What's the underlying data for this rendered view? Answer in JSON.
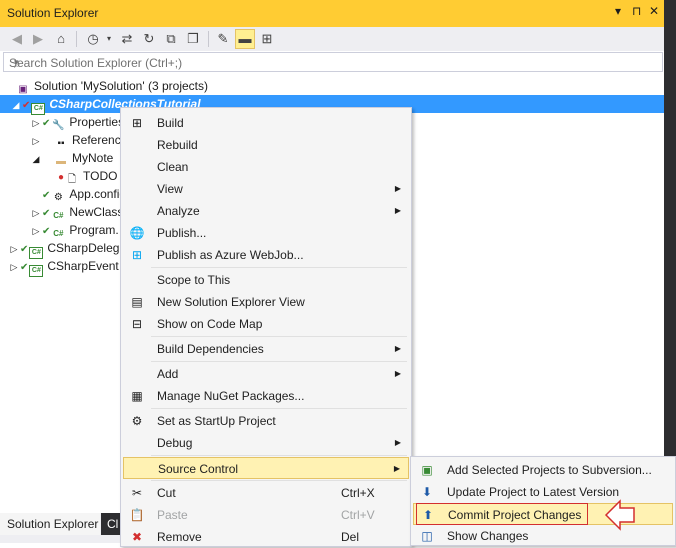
{
  "title_bar": {
    "title": "Solution Explorer",
    "dropdown_glyph": "▾",
    "pin_glyph": "⊓",
    "close_glyph": "✕"
  },
  "toolbar": {
    "icons": [
      "back-icon",
      "forward-icon",
      "home-icon",
      "history-icon",
      "sync-icon",
      "refresh-icon",
      "collapse-all-icon",
      "show-all-files-icon",
      "properties-icon",
      "preview-icon",
      "class-view-icon"
    ]
  },
  "search": {
    "placeholder": "Search Solution Explorer (Ctrl+;)",
    "icon_glyph": "⌕",
    "dropdown_glyph": "▾"
  },
  "tree": {
    "solution": "Solution 'MySolution' (3 projects)",
    "items": [
      {
        "label": "CSharpCollectionsTutorial"
      },
      {
        "label": "Properties"
      },
      {
        "label": "References"
      },
      {
        "label": "MyNote"
      },
      {
        "label": "TODO"
      },
      {
        "label": "App.config"
      },
      {
        "label": "NewClass"
      },
      {
        "label": "Program."
      },
      {
        "label": "CSharpDeleg"
      },
      {
        "label": "CSharpEvent"
      }
    ]
  },
  "bottom_tabs": {
    "tab1": "Solution Explorer",
    "tab2": "Cl"
  },
  "context_menu": {
    "items": {
      "build": "Build",
      "rebuild": "Rebuild",
      "clean": "Clean",
      "view": "View",
      "analyze": "Analyze",
      "publish": "Publish...",
      "publish_azure": "Publish as Azure WebJob...",
      "scope": "Scope to This",
      "new_view": "New Solution Explorer View",
      "code_map": "Show on Code Map",
      "build_deps": "Build Dependencies",
      "add": "Add",
      "nuget": "Manage NuGet Packages...",
      "startup": "Set as StartUp Project",
      "debug": "Debug",
      "source_control": "Source Control",
      "cut": "Cut",
      "cut_shortcut": "Ctrl+X",
      "paste": "Paste",
      "paste_shortcut": "Ctrl+V",
      "remove": "Remove",
      "remove_shortcut": "Del"
    }
  },
  "source_control_menu": {
    "add_to_svn": "Add Selected Projects to Subversion...",
    "update": "Update Project to Latest Version",
    "commit": "Commit Project Changes",
    "show_changes": "Show Changes"
  },
  "colors": {
    "title_bar": "#ffcc33",
    "selection": "#3399ff",
    "menu_highlight": "#fff2b3",
    "annotation_red": "#d32f2f"
  }
}
